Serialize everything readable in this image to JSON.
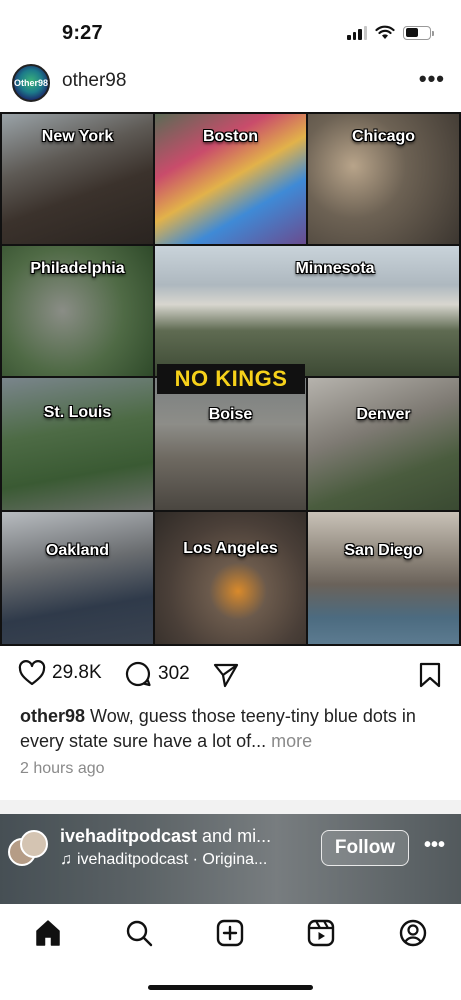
{
  "status_bar": {
    "time": "9:27"
  },
  "post": {
    "avatar_text": "Other98",
    "username": "other98",
    "banner": "NO KINGS",
    "tiles": [
      {
        "label": "New York"
      },
      {
        "label": "Boston"
      },
      {
        "label": "Chicago"
      },
      {
        "label": "Philadelphia"
      },
      {
        "label": "Minnesota"
      },
      {
        "label": "St. Louis"
      },
      {
        "label": "Boise"
      },
      {
        "label": "Denver"
      },
      {
        "label": "Oakland"
      },
      {
        "label": "Los Angeles"
      },
      {
        "label": "San Diego"
      }
    ],
    "likes": "29.8K",
    "comments": "302",
    "caption_user": "other98",
    "caption_text": "Wow, guess those teeny-tiny blue dots in every state sure have a lot of...",
    "caption_more": "more",
    "timestamp": "2 hours ago"
  },
  "reel": {
    "title_user": "ivehaditpodcast",
    "title_rest": "and mi...",
    "audio_text": "ivehaditpodcast · Origina...",
    "follow_label": "Follow"
  },
  "colors": {
    "banner_text": "#f6d11a",
    "muted_text": "#8a8a8a"
  },
  "icons": {
    "nav": [
      "home-icon",
      "search-icon",
      "create-icon",
      "reels-icon",
      "profile-icon"
    ],
    "actions": [
      "heart-icon",
      "comment-icon",
      "share-icon",
      "bookmark-icon"
    ]
  }
}
